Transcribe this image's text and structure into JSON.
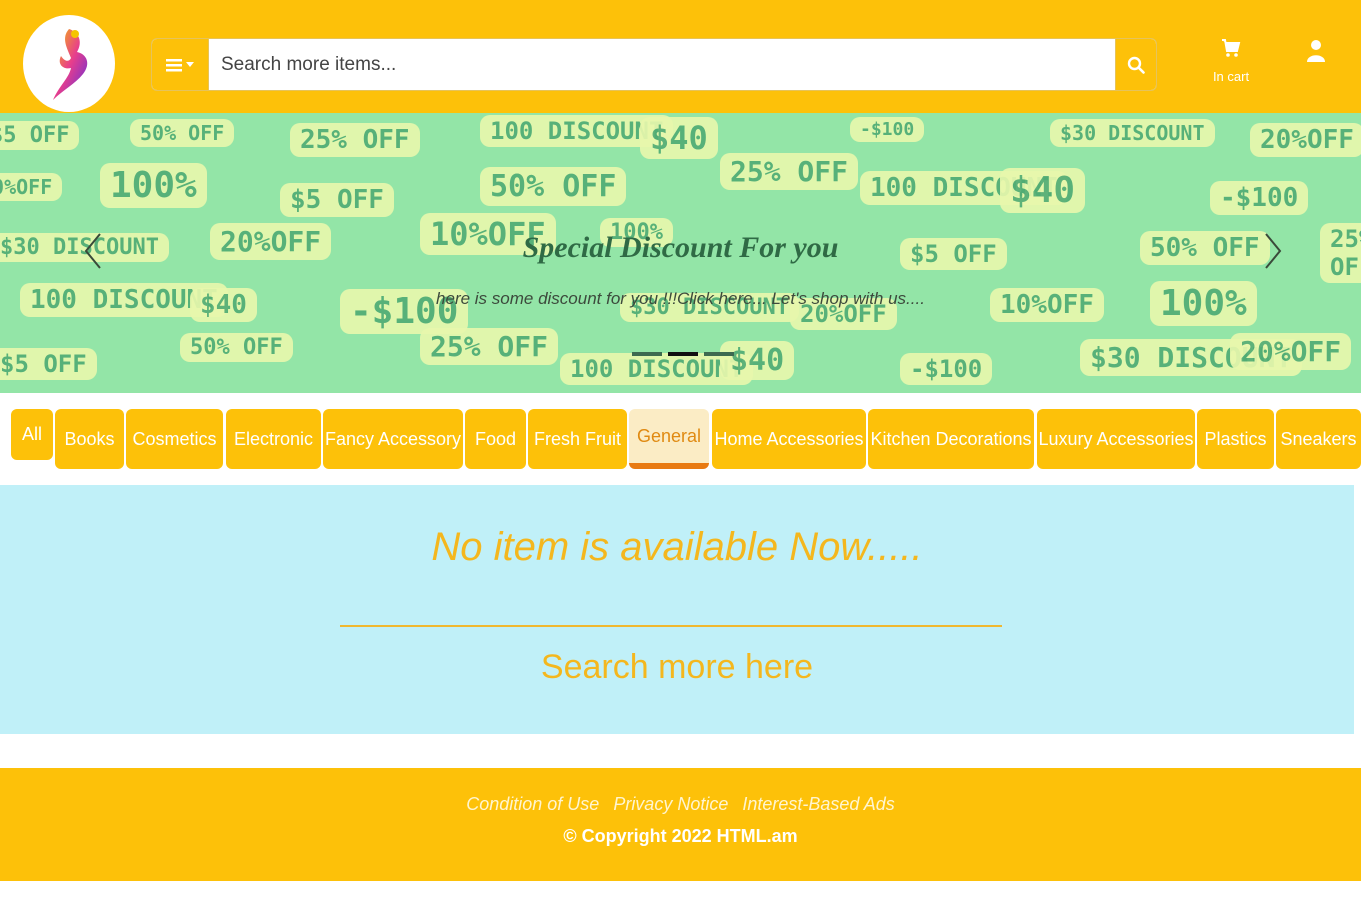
{
  "header": {
    "search_placeholder": "Search more items...",
    "cart_label": "In cart"
  },
  "carousel": {
    "title": "Special Discount For you",
    "text": "here is some discount for you !!!Click here... Let's shop with us....",
    "background_tags": [
      "$5 OFF",
      "50% OFF",
      "25% OFF",
      "100 DISCOUNT",
      "$40",
      "-$100",
      "$30 DISCOUNT",
      "20%OFF",
      "10%OFF",
      "100%"
    ],
    "slide_count": 3,
    "active_slide": 2
  },
  "categories": [
    "All",
    "Books",
    "Cosmetics",
    "Electronic",
    "Fancy Accessory",
    "Food",
    "Fresh Fruit",
    "General",
    "Home Accessories",
    "Kitchen Decorations",
    "Luxury Accessories",
    "Plastics",
    "Sneakers"
  ],
  "active_category": "General",
  "main": {
    "empty_message": "No item is available Now.....",
    "search_link": "Search more here"
  },
  "footer": {
    "links": [
      "Condition of Use",
      "Privacy Notice",
      "Interest-Based Ads"
    ],
    "copyright": "© Copyright 2022 HTML.am"
  },
  "colors": {
    "brand": "#fdc109",
    "main_bg": "#c0f0f8",
    "accent_text": "#f4b71e",
    "active_tab_bg": "#fbecc5",
    "active_tab_border": "#e87a12"
  }
}
